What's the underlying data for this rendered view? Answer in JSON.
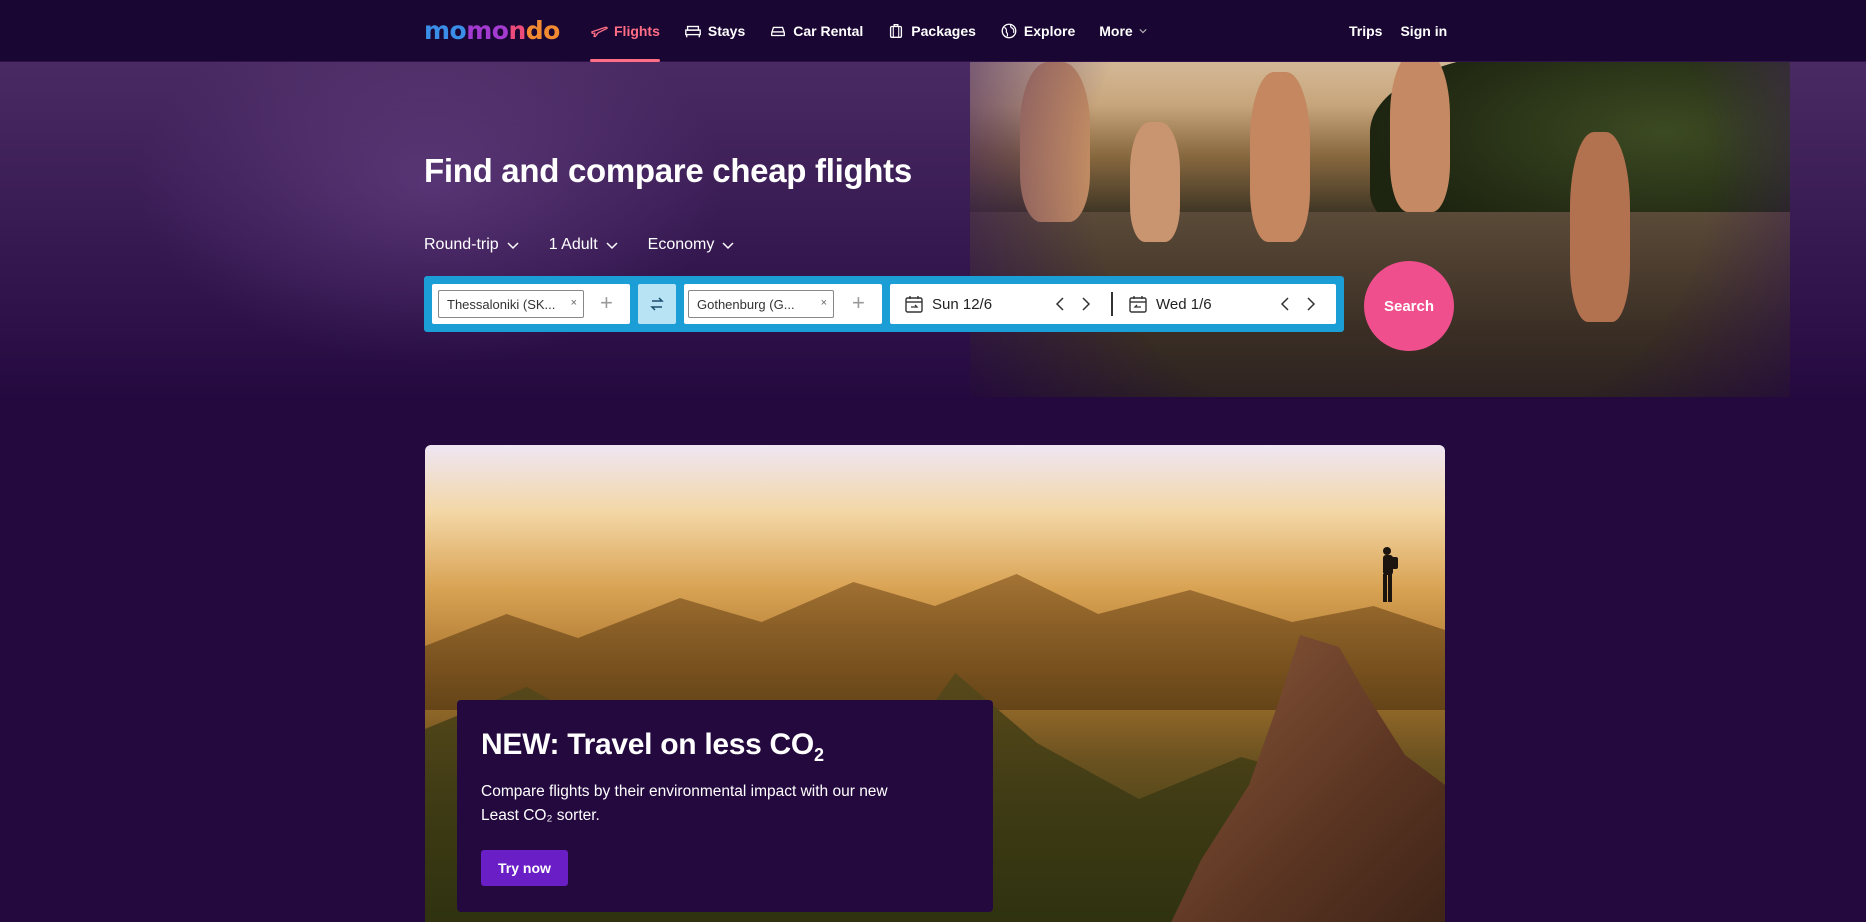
{
  "brand": {
    "logo_parts": [
      "mo",
      "mo",
      "n",
      "do"
    ]
  },
  "nav": {
    "items": [
      {
        "label": "Flights",
        "icon": "plane-icon",
        "active": true
      },
      {
        "label": "Stays",
        "icon": "bed-icon",
        "active": false
      },
      {
        "label": "Car Rental",
        "icon": "car-icon",
        "active": false
      },
      {
        "label": "Packages",
        "icon": "suitcase-icon",
        "active": false
      },
      {
        "label": "Explore",
        "icon": "globe-icon",
        "active": false
      },
      {
        "label": "More",
        "icon": "chevron-down-icon",
        "active": false
      }
    ],
    "trips": "Trips",
    "sign_in": "Sign in"
  },
  "hero": {
    "title": "Find and compare cheap flights",
    "trip_type": "Round-trip",
    "travelers": "1 Adult",
    "cabin": "Economy"
  },
  "search": {
    "origin": "Thessaloniki (SK...",
    "destination": "Gothenburg (G...",
    "depart_date": "Sun 12/6",
    "return_date": "Wed 1/6",
    "button": "Search"
  },
  "promo": {
    "title_prefix": "NEW: Travel on less CO",
    "title_sub": "2",
    "desc_line1": "Compare flights by their environmental impact with our new",
    "desc_line2": "Least CO₂ sorter.",
    "button": "Try now"
  },
  "colors": {
    "background": "#24093f",
    "nav_active": "#ff6e86",
    "search_bar": "#1b9ed6",
    "search_button": "#ef4f8c",
    "promo_button": "#6a1fc6"
  }
}
